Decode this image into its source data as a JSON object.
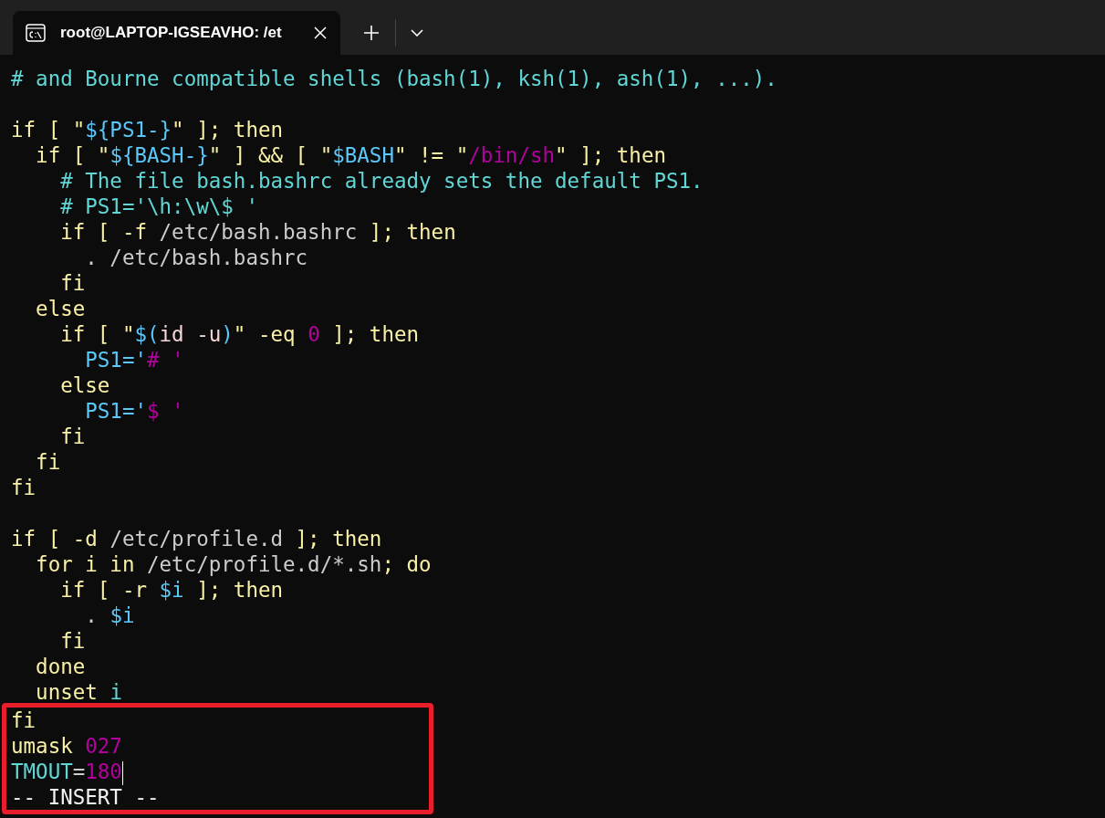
{
  "tab": {
    "title": "root@LAPTOP-IGSEAVHO: /et",
    "selected": true
  },
  "lines": [
    {
      "kind": "code",
      "segments": [
        {
          "kind": "comment",
          "text": "# and Bourne compatible shells (bash(1), ksh(1), ash(1), ...)."
        }
      ]
    },
    {
      "kind": "blank"
    },
    {
      "kind": "code",
      "segments": [
        {
          "kind": "keyword",
          "text": "if [ \""
        },
        {
          "kind": "variable",
          "text": "${PS1-}"
        },
        {
          "kind": "keyword",
          "text": "\" ]; then"
        }
      ]
    },
    {
      "kind": "code",
      "segments": [
        {
          "kind": "keyword",
          "text": "  if [ \""
        },
        {
          "kind": "variable",
          "text": "${BASH-}"
        },
        {
          "kind": "keyword",
          "text": "\" ] && [ \""
        },
        {
          "kind": "variable",
          "text": "$BASH"
        },
        {
          "kind": "keyword",
          "text": "\" != \""
        },
        {
          "kind": "constant",
          "text": "/bin/sh"
        },
        {
          "kind": "keyword",
          "text": "\" ]; then"
        }
      ]
    },
    {
      "kind": "code",
      "segments": [
        {
          "kind": "comment",
          "text": "    # The file bash.bashrc already sets the default PS1."
        }
      ]
    },
    {
      "kind": "code",
      "segments": [
        {
          "kind": "comment",
          "text": "    # PS1='\\h:\\w\\$ '"
        }
      ]
    },
    {
      "kind": "code",
      "segments": [
        {
          "kind": "keyword",
          "text": "    if [ -f "
        },
        {
          "kind": "plain",
          "text": "/etc/bash.bashrc"
        },
        {
          "kind": "keyword",
          "text": " ]; then"
        }
      ]
    },
    {
      "kind": "code",
      "segments": [
        {
          "kind": "plain",
          "text": "      . /etc/bash.bashrc"
        }
      ]
    },
    {
      "kind": "code",
      "segments": [
        {
          "kind": "keyword",
          "text": "    fi"
        }
      ]
    },
    {
      "kind": "code",
      "segments": [
        {
          "kind": "keyword",
          "text": "  else"
        }
      ]
    },
    {
      "kind": "code",
      "segments": [
        {
          "kind": "keyword",
          "text": "    if [ \""
        },
        {
          "kind": "variable",
          "text": "$("
        },
        {
          "kind": "command",
          "text": "id -u"
        },
        {
          "kind": "variable",
          "text": ")"
        },
        {
          "kind": "keyword",
          "text": "\" -eq "
        },
        {
          "kind": "constant",
          "text": "0"
        },
        {
          "kind": "keyword",
          "text": " ]; then"
        }
      ]
    },
    {
      "kind": "code",
      "segments": [
        {
          "kind": "variable",
          "text": "      PS1='"
        },
        {
          "kind": "constant",
          "text": "# '"
        }
      ]
    },
    {
      "kind": "code",
      "segments": [
        {
          "kind": "keyword",
          "text": "    else"
        }
      ]
    },
    {
      "kind": "code",
      "segments": [
        {
          "kind": "variable",
          "text": "      PS1='"
        },
        {
          "kind": "constant",
          "text": "$ '"
        }
      ]
    },
    {
      "kind": "code",
      "segments": [
        {
          "kind": "keyword",
          "text": "    fi"
        }
      ]
    },
    {
      "kind": "code",
      "segments": [
        {
          "kind": "keyword",
          "text": "  fi"
        }
      ]
    },
    {
      "kind": "code",
      "segments": [
        {
          "kind": "keyword",
          "text": "fi"
        }
      ]
    },
    {
      "kind": "blank"
    },
    {
      "kind": "code",
      "segments": [
        {
          "kind": "keyword",
          "text": "if [ -d "
        },
        {
          "kind": "plain",
          "text": "/etc/profile.d"
        },
        {
          "kind": "keyword",
          "text": " ]; then"
        }
      ]
    },
    {
      "kind": "code",
      "segments": [
        {
          "kind": "keyword",
          "text": "  for i in "
        },
        {
          "kind": "plain",
          "text": "/etc/profile.d/*.sh"
        },
        {
          "kind": "keyword",
          "text": "; do"
        }
      ]
    },
    {
      "kind": "code",
      "segments": [
        {
          "kind": "keyword",
          "text": "    if [ -r "
        },
        {
          "kind": "variable",
          "text": "$i"
        },
        {
          "kind": "keyword",
          "text": " ]; then"
        }
      ]
    },
    {
      "kind": "code",
      "segments": [
        {
          "kind": "plain",
          "text": "      . "
        },
        {
          "kind": "variable",
          "text": "$i"
        }
      ]
    },
    {
      "kind": "code",
      "segments": [
        {
          "kind": "keyword",
          "text": "    fi"
        }
      ]
    },
    {
      "kind": "code",
      "segments": [
        {
          "kind": "keyword",
          "text": "  done"
        }
      ]
    },
    {
      "kind": "code",
      "segments": [
        {
          "kind": "keyword",
          "text": "  unset "
        },
        {
          "kind": "comment",
          "text": "i"
        }
      ]
    }
  ],
  "highlight_box": {
    "lines": [
      {
        "cursor": false,
        "segments": [
          {
            "kind": "keyword",
            "text": "fi"
          }
        ]
      },
      {
        "cursor": false,
        "segments": [
          {
            "kind": "keyword",
            "text": "umask "
          },
          {
            "kind": "constant",
            "text": "027"
          }
        ]
      },
      {
        "cursor": true,
        "segments": [
          {
            "kind": "comment",
            "text": "TMOUT"
          },
          {
            "kind": "plain",
            "text": "="
          },
          {
            "kind": "constant",
            "text": "180"
          }
        ]
      }
    ],
    "status": "-- INSERT --"
  }
}
